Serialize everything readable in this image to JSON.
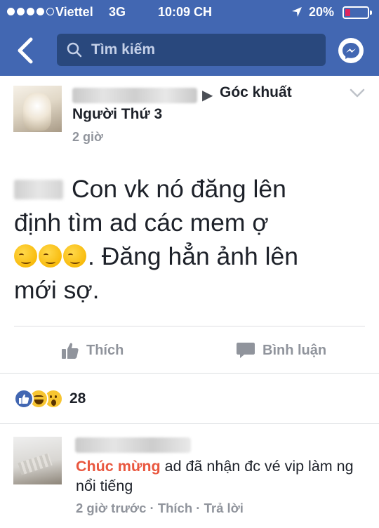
{
  "status_bar": {
    "carrier": "Viettel",
    "network": "3G",
    "time": "10:09 CH",
    "battery": "20%",
    "battery_color": "#e0245e"
  },
  "nav": {
    "search_placeholder": "Tìm kiếm",
    "accent": "#4267b2",
    "icons": [
      "back-icon",
      "search-icon",
      "messenger-icon"
    ]
  },
  "post": {
    "group": "Góc khuất",
    "group_sub": "Người Thứ 3",
    "time": "2 giờ",
    "text_line1": "Con vk nó đăng lên",
    "text_line2": "định tìm ad các mem ợ",
    "text_line3": ". Đăng hẳn ảnh lên",
    "text_line4": "mới sợ.",
    "emoji_name": "smirking-face-icon",
    "like_label": "Thích",
    "comment_label": "Bình luận",
    "reactions": [
      "like",
      "haha",
      "wow"
    ],
    "reaction_count": "28"
  },
  "comment": {
    "highlight": "Chúc mừng",
    "text_rest": " ad đã nhận đc vé vip làm ng nổi tiếng",
    "time": "2 giờ trước",
    "sep": " · ",
    "like": "Thích",
    "reply": "Trả lời",
    "highlight_color": "#e9573f"
  }
}
